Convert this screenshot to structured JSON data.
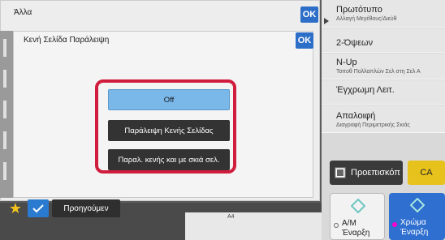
{
  "outer_dialog": {
    "title": "Άλλα",
    "ok_label": "OK"
  },
  "inner_dialog": {
    "title": "Κενή Σελίδα Παράλειψη",
    "ok_label": "OK",
    "options": [
      {
        "label": "Off",
        "selected": true
      },
      {
        "label": "Παράλειψη Κενής Σελίδας",
        "selected": false
      },
      {
        "label": "Παραλ. κενής και με σκιά σελ.",
        "selected": false
      }
    ]
  },
  "right_panel": {
    "items": [
      {
        "title": "Πρωτότυπο",
        "subtitle": "Αλλαγή Μεγέθους/Διεύθ"
      },
      {
        "title": "2-Όψεων",
        "subtitle": ""
      },
      {
        "title": "N-Up",
        "subtitle": "Τοποθ Πολλαπλών Σελ στη Σελ Α"
      },
      {
        "title": "Έγχρωμη Λειτ.",
        "subtitle": ""
      },
      {
        "title": "Απαλοιφή",
        "subtitle": "Διαγραφή Περιμετρικής Σκιάς"
      }
    ],
    "preview_label": "Προεπισκόπ",
    "ca_label": "CA",
    "start_bw": {
      "line1": "Α/Μ",
      "line2": "Έναρξη"
    },
    "start_color": {
      "line1": "Χρώμα",
      "line2": "Έναρξη"
    }
  },
  "bottom": {
    "prev_label": "Προηγούμεν",
    "scale_label": "A4"
  },
  "colors": {
    "accent": "#2d6fc8",
    "highlight": "#d11d3d",
    "selected": "#7ab8ea",
    "ca": "#e8c21c"
  }
}
